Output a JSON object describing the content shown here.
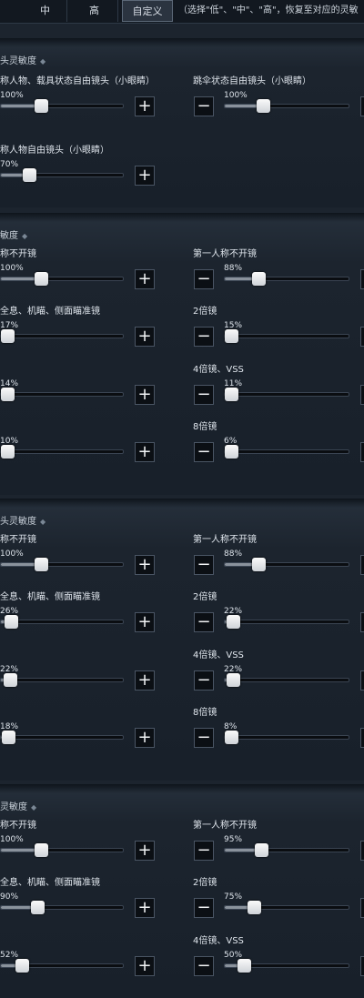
{
  "tabs": {
    "mid": "中",
    "high": "高",
    "custom": "自定义",
    "hint": "（选择\"低\"、\"中\"、\"高\"，恢复至对应的灵敏"
  },
  "sections": [
    {
      "title": "头灵敏度",
      "items": [
        {
          "label": "称人物、载具状态自由镜头（小眼睛）",
          "value": "100%",
          "level": 100,
          "side": "left"
        },
        {
          "label": "跳伞状态自由镜头（小眼睛）",
          "value": "100%",
          "level": 100,
          "side": "right"
        },
        {
          "label": "称人物自由镜头（小眼睛）",
          "value": "70%",
          "level": 70,
          "side": "left"
        }
      ]
    },
    {
      "title": "敏度",
      "items": [
        {
          "label": "称不开镜",
          "value": "100%",
          "level": 100,
          "side": "left"
        },
        {
          "label": "第一人称不开镜",
          "value": "88%",
          "level": 88,
          "side": "right"
        },
        {
          "label": "全息、机瞄、侧面瞄准镜",
          "value": "17%",
          "level": 17,
          "side": "left"
        },
        {
          "label": "2倍镜",
          "value": "15%",
          "level": 15,
          "side": "right"
        },
        {
          "label": "",
          "value": "14%",
          "level": 14,
          "side": "left"
        },
        {
          "label": "4倍镜、VSS",
          "value": "11%",
          "level": 11,
          "side": "right"
        },
        {
          "label": "",
          "value": "10%",
          "level": 10,
          "side": "left"
        },
        {
          "label": "8倍镜",
          "value": "6%",
          "level": 6,
          "side": "right"
        }
      ]
    },
    {
      "title": "头灵敏度",
      "items": [
        {
          "label": "称不开镜",
          "value": "100%",
          "level": 100,
          "side": "left"
        },
        {
          "label": "第一人称不开镜",
          "value": "88%",
          "level": 88,
          "side": "right"
        },
        {
          "label": "全息、机瞄、侧面瞄准镜",
          "value": "26%",
          "level": 26,
          "side": "left"
        },
        {
          "label": "2倍镜",
          "value": "22%",
          "level": 22,
          "side": "right"
        },
        {
          "label": "",
          "value": "22%",
          "level": 22,
          "side": "left"
        },
        {
          "label": "4倍镜、VSS",
          "value": "22%",
          "level": 22,
          "side": "right"
        },
        {
          "label": "",
          "value": "18%",
          "level": 18,
          "side": "left"
        },
        {
          "label": "8倍镜",
          "value": "8%",
          "level": 8,
          "side": "right"
        }
      ]
    },
    {
      "title": "灵敏度",
      "items": [
        {
          "label": "称不开镜",
          "value": "100%",
          "level": 100,
          "side": "left"
        },
        {
          "label": "第一人称不开镜",
          "value": "95%",
          "level": 95,
          "side": "right"
        },
        {
          "label": "全息、机瞄、侧面瞄准镜",
          "value": "90%",
          "level": 90,
          "side": "left"
        },
        {
          "label": "2倍镜",
          "value": "75%",
          "level": 75,
          "side": "right"
        },
        {
          "label": "",
          "value": "52%",
          "level": 52,
          "side": "left"
        },
        {
          "label": "4倍镜、VSS",
          "value": "50%",
          "level": 50,
          "side": "right"
        }
      ]
    }
  ],
  "buttons": {
    "plus": "+",
    "minus": "−"
  }
}
